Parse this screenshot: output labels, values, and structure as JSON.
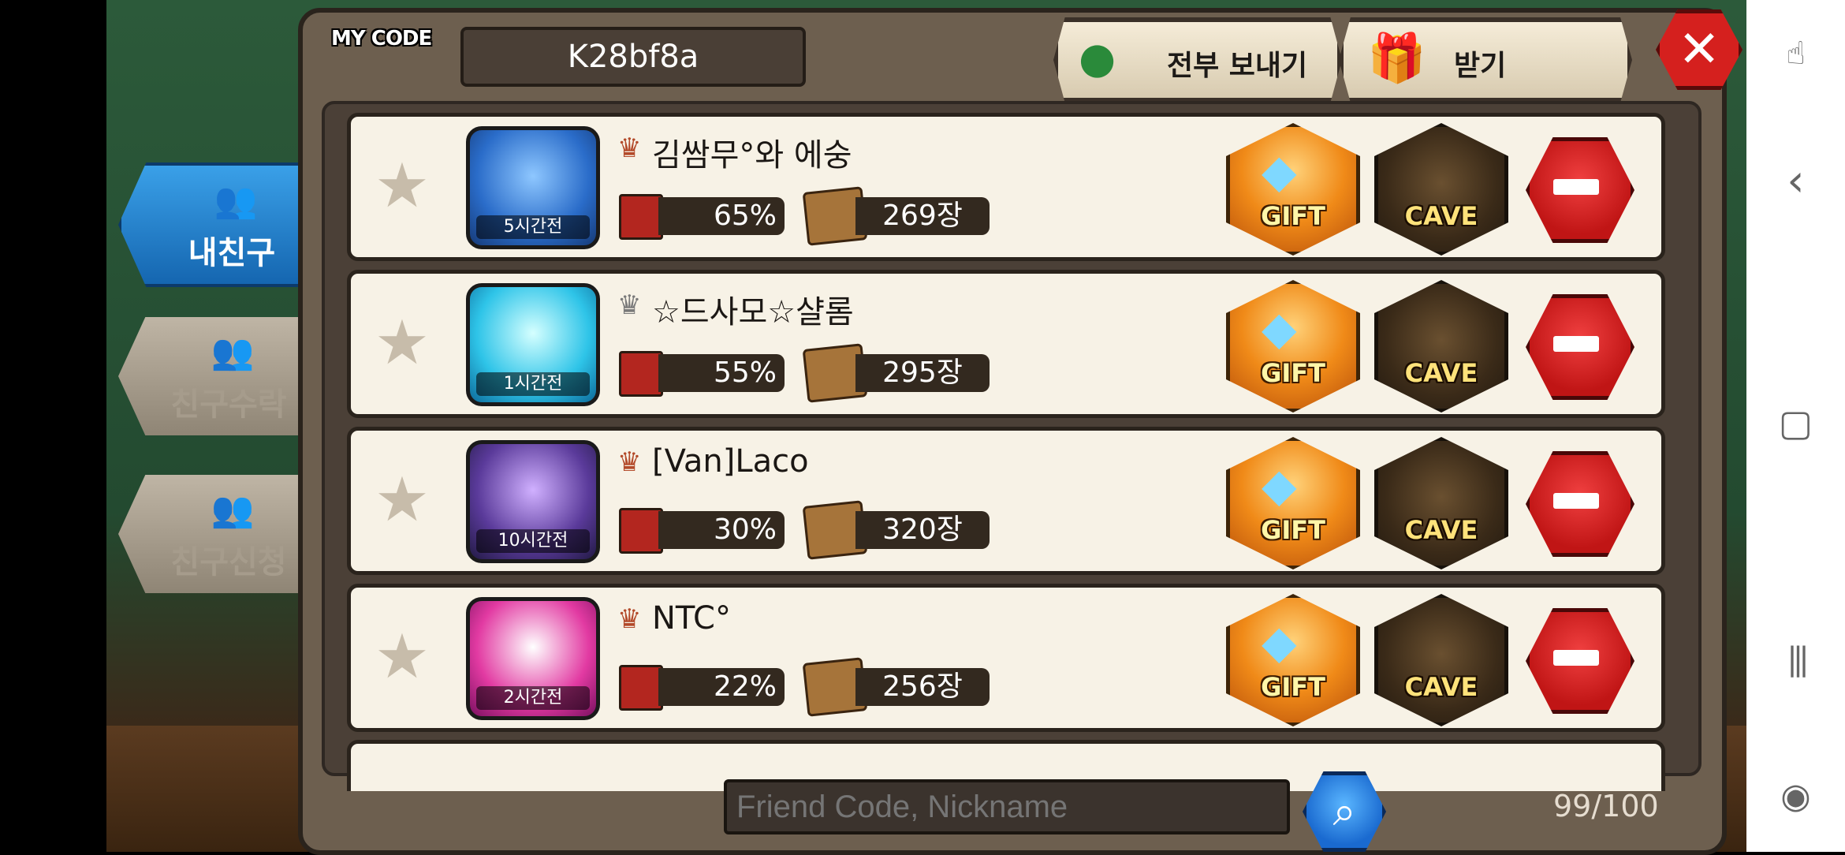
{
  "header": {
    "my_code_label": "MY CODE",
    "my_code_value": "K28bf8a",
    "send_all_label": "전부 보내기",
    "receive_label": "받기",
    "close_icon": "close-x"
  },
  "side_tabs": [
    {
      "label": "내친구",
      "active": true,
      "icon": "people-icon"
    },
    {
      "label": "친구수락",
      "active": false,
      "icon": "people-icon"
    },
    {
      "label": "친구신청",
      "active": false,
      "icon": "people-icon"
    }
  ],
  "friends": [
    {
      "name": "김쌈무°와 에숭",
      "time": "5시간전",
      "percent": "65%",
      "cards": "269장",
      "gift_label": "GIFT",
      "cave_label": "CAVE"
    },
    {
      "name": "☆드사모☆샬롬",
      "time": "1시간전",
      "percent": "55%",
      "cards": "295장",
      "gift_label": "GIFT",
      "cave_label": "CAVE"
    },
    {
      "name": "[Van]Laco",
      "time": "10시간전",
      "percent": "30%",
      "cards": "320장",
      "gift_label": "GIFT",
      "cave_label": "CAVE"
    },
    {
      "name": "NTC°",
      "time": "2시간전",
      "percent": "22%",
      "cards": "256장",
      "gift_label": "GIFT",
      "cave_label": "CAVE"
    }
  ],
  "search": {
    "placeholder": "Friend Code, Nickname"
  },
  "friend_count": "99/100",
  "colors": {
    "panel": "#6d5f4f",
    "row_bg": "#f7f2e6",
    "tab_active": "#1e7ad0",
    "gift": "#f08a18",
    "remove": "#d5201e"
  }
}
